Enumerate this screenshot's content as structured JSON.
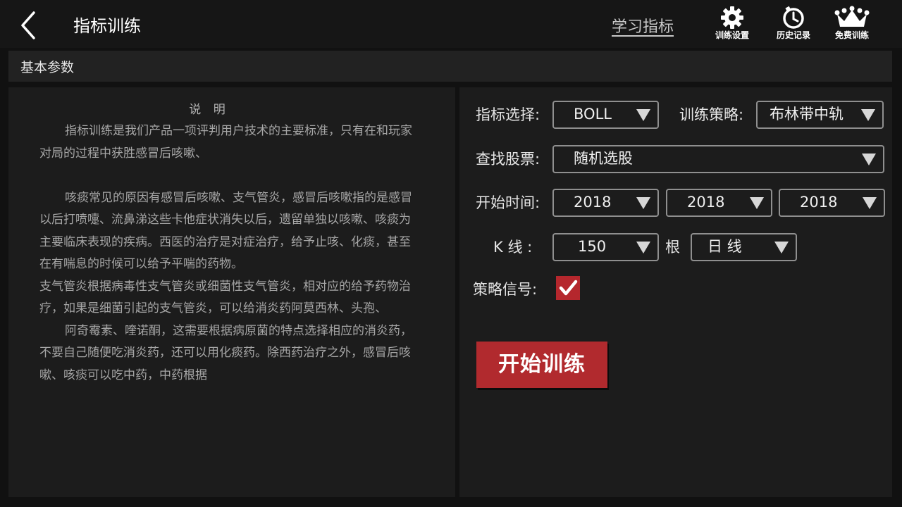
{
  "header": {
    "title": "指标训练",
    "learn_link": "学习指标",
    "tools": [
      {
        "label": "训练设置",
        "icon": "gear-icon"
      },
      {
        "label": "历史记录",
        "icon": "clock-icon"
      },
      {
        "label": "免费训练",
        "icon": "crown-icon"
      }
    ]
  },
  "section_title": "基本参数",
  "description": {
    "title": "说 明",
    "paragraphs": [
      "指标训练是我们产品一项评判用户技术的主要标准，只有在和玩家对局的过程中获胜感冒后咳嗽、",
      "咳痰常见的原因有感冒后咳嗽、支气管炎，感冒后咳嗽指的是感冒以后打喷嚏、流鼻涕这些卡他症状消失以后，遗留单独以咳嗽、咳痰为主要临床表现的疾病。西医的治疗是对症治疗，给予止咳、化痰，甚至在有喘息的时候可以给予平喘的药物。",
      "支气管炎根据病毒性支气管炎或细菌性支气管炎，相对应的给予药物治疗，如果是细菌引起的支气管炎，可以给消炎药阿莫西林、头孢、",
      "阿奇霉素、喹诺酮，这需要根据病原菌的特点选择相应的消炎药，不要自己随便吃消炎药，还可以用化痰药。除西药治疗之外，感冒后咳嗽、咳痰可以吃中药，中药根据"
    ]
  },
  "form": {
    "indicator_label": "指标选择:",
    "indicator_value": "BOLL",
    "strategy_label": "训练策略:",
    "strategy_value": "布林带中轨",
    "stock_label": "查找股票:",
    "stock_value": "随机选股",
    "start_time_label": "开始时间:",
    "start_year": "2018",
    "start_month": "2018",
    "start_day": "2018",
    "kline_label": "K 线 :",
    "kline_count": "150",
    "kline_unit": "根",
    "kline_period": "日 线",
    "signal_label": "策略信号:",
    "signal_checked": true,
    "start_button": "开始训练"
  },
  "colors": {
    "accent": "#b12a2e",
    "background": "#111111",
    "panel": "#1c1c1c"
  }
}
